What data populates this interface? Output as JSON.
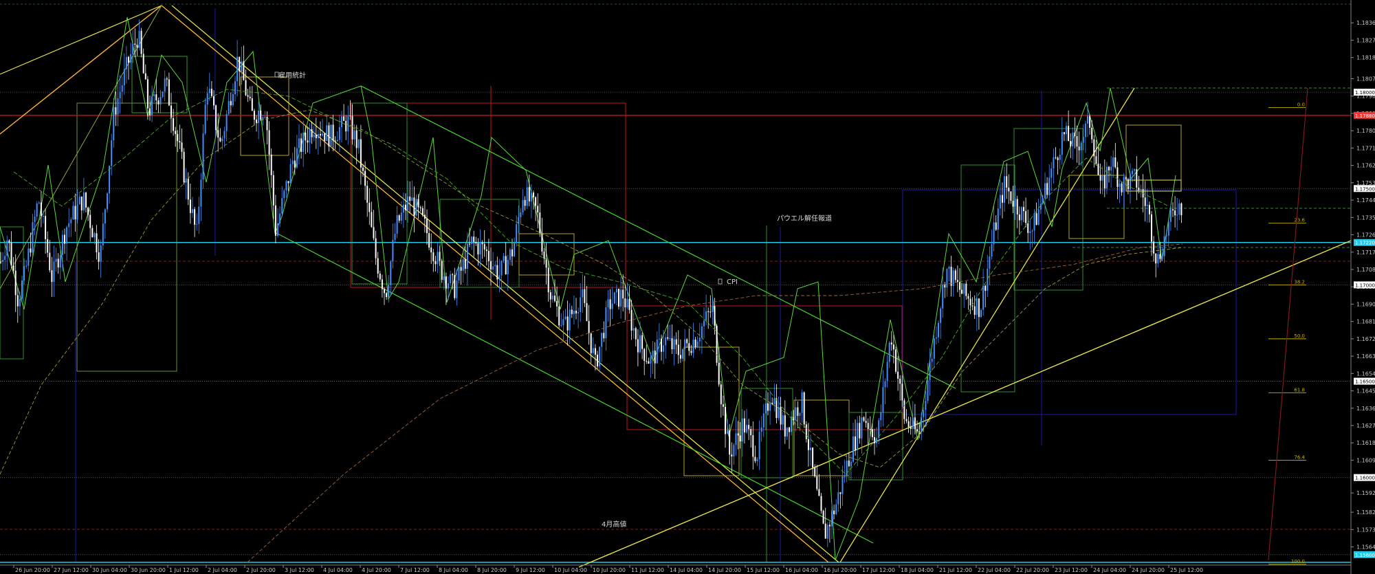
{
  "colors": {
    "background": "#000000",
    "candle_up": "#3f8fff",
    "candle_down": "#ffffff",
    "grid": "#6a6a6a",
    "red_level": "#e00000",
    "cyan_level": "#27c8e6",
    "green_line": "#44d62c",
    "yellow_line": "#e6e24a",
    "orange_line": "#ffb43a",
    "blue_box": "#1a1aa8",
    "red_box": "#c01818",
    "fib": "#c8b400"
  },
  "chart_data": {
    "type": "line",
    "ylim": [
      1.1556,
      1.1845
    ],
    "price_ticks": [
      "1.18360",
      "1.18270",
      "1.18180",
      "1.18070",
      "1.17980",
      "1.17890",
      "1.17800",
      "1.17710",
      "1.17620",
      "1.17530",
      "1.17440",
      "1.17350",
      "1.17260",
      "1.17170",
      "1.17080",
      "1.16990",
      "1.16900",
      "1.16810",
      "1.16720",
      "1.16630",
      "1.16540",
      "1.16450",
      "1.16360",
      "1.16270",
      "1.16180",
      "1.16090",
      "1.15920",
      "1.15820",
      "1.15730",
      "1.15640"
    ],
    "highlight_prices": [
      {
        "label": "1.18000",
        "value": 1.18,
        "color": "#ffffff"
      },
      {
        "label": "1.17880",
        "value": 1.1788,
        "color": "#ff3030"
      },
      {
        "label": "1.17500",
        "value": 1.175,
        "color": "#ffffff"
      },
      {
        "label": "1.17220",
        "value": 1.1722,
        "color": "#27c8e6"
      },
      {
        "label": "1.17000",
        "value": 1.17,
        "color": "#ffffff"
      },
      {
        "label": "1.16500",
        "value": 1.165,
        "color": "#ffffff"
      },
      {
        "label": "1.16000",
        "value": 1.16,
        "color": "#ffffff"
      },
      {
        "label": "1.15600",
        "value": 1.156,
        "color": "#27c8e6"
      }
    ],
    "time_labels": [
      "26 Jun 20:00",
      "27 Jun 12:00",
      "30 Jun 04:00",
      "30 Jun 20:00",
      "1 Jul 12:00",
      "2 Jul 04:00",
      "2 Jul 20:00",
      "3 Jul 12:00",
      "4 Jul 04:00",
      "4 Jul 20:00",
      "7 Jul 12:00",
      "8 Jul 04:00",
      "8 Jul 20:00",
      "9 Jul 12:00",
      "10 Jul 04:00",
      "10 Jul 20:00",
      "11 Jul 12:00",
      "14 Jul 04:00",
      "14 Jul 20:00",
      "15 Jul 12:00",
      "16 Jul 04:00",
      "16 Jul 20:00",
      "17 Jul 12:00",
      "18 Jul 04:00",
      "21 Jul 12:00",
      "22 Jul 04:00",
      "22 Jul 20:00",
      "23 Jul 12:00",
      "24 Jul 04:00",
      "24 Jul 20:00",
      "25 Jul 12:00"
    ],
    "price_path": [
      {
        "x": 0,
        "y": 1.1712
      },
      {
        "x": 10,
        "y": 1.1725
      },
      {
        "x": 25,
        "y": 1.1693
      },
      {
        "x": 35,
        "y": 1.1705
      },
      {
        "x": 55,
        "y": 1.1745
      },
      {
        "x": 75,
        "y": 1.1703
      },
      {
        "x": 95,
        "y": 1.173
      },
      {
        "x": 120,
        "y": 1.1745
      },
      {
        "x": 145,
        "y": 1.1715
      },
      {
        "x": 165,
        "y": 1.179
      },
      {
        "x": 185,
        "y": 1.1815
      },
      {
        "x": 200,
        "y": 1.183
      },
      {
        "x": 215,
        "y": 1.179
      },
      {
        "x": 240,
        "y": 1.1805
      },
      {
        "x": 260,
        "y": 1.177
      },
      {
        "x": 285,
        "y": 1.1725
      },
      {
        "x": 300,
        "y": 1.1805
      },
      {
        "x": 320,
        "y": 1.1772
      },
      {
        "x": 345,
        "y": 1.1818
      },
      {
        "x": 365,
        "y": 1.1788
      },
      {
        "x": 385,
        "y": 1.1792
      },
      {
        "x": 400,
        "y": 1.1728
      },
      {
        "x": 425,
        "y": 1.1765
      },
      {
        "x": 455,
        "y": 1.1783
      },
      {
        "x": 480,
        "y": 1.1777
      },
      {
        "x": 505,
        "y": 1.1785
      },
      {
        "x": 520,
        "y": 1.1772
      },
      {
        "x": 545,
        "y": 1.1715
      },
      {
        "x": 560,
        "y": 1.1695
      },
      {
        "x": 575,
        "y": 1.173
      },
      {
        "x": 595,
        "y": 1.1745
      },
      {
        "x": 615,
        "y": 1.1732
      },
      {
        "x": 640,
        "y": 1.1708
      },
      {
        "x": 660,
        "y": 1.1698
      },
      {
        "x": 685,
        "y": 1.1722
      },
      {
        "x": 705,
        "y": 1.1718
      },
      {
        "x": 725,
        "y": 1.1705
      },
      {
        "x": 745,
        "y": 1.1718
      },
      {
        "x": 760,
        "y": 1.1748
      },
      {
        "x": 780,
        "y": 1.1738
      },
      {
        "x": 800,
        "y": 1.1695
      },
      {
        "x": 820,
        "y": 1.1678
      },
      {
        "x": 845,
        "y": 1.1695
      },
      {
        "x": 865,
        "y": 1.1658
      },
      {
        "x": 885,
        "y": 1.169
      },
      {
        "x": 905,
        "y": 1.1695
      },
      {
        "x": 925,
        "y": 1.1672
      },
      {
        "x": 945,
        "y": 1.166
      },
      {
        "x": 965,
        "y": 1.1672
      },
      {
        "x": 985,
        "y": 1.1665
      },
      {
        "x": 1010,
        "y": 1.1672
      },
      {
        "x": 1035,
        "y": 1.1688
      },
      {
        "x": 1048,
        "y": 1.1642
      },
      {
        "x": 1060,
        "y": 1.1612
      },
      {
        "x": 1080,
        "y": 1.1628
      },
      {
        "x": 1100,
        "y": 1.1612
      },
      {
        "x": 1120,
        "y": 1.1645
      },
      {
        "x": 1140,
        "y": 1.1625
      },
      {
        "x": 1165,
        "y": 1.164
      },
      {
        "x": 1180,
        "y": 1.1605
      },
      {
        "x": 1198,
        "y": 1.157
      },
      {
        "x": 1215,
        "y": 1.1586
      },
      {
        "x": 1235,
        "y": 1.1612
      },
      {
        "x": 1255,
        "y": 1.1632
      },
      {
        "x": 1275,
        "y": 1.162
      },
      {
        "x": 1295,
        "y": 1.1675
      },
      {
        "x": 1315,
        "y": 1.163
      },
      {
        "x": 1335,
        "y": 1.1622
      },
      {
        "x": 1355,
        "y": 1.1665
      },
      {
        "x": 1375,
        "y": 1.1708
      },
      {
        "x": 1400,
        "y": 1.1695
      },
      {
        "x": 1425,
        "y": 1.1688
      },
      {
        "x": 1445,
        "y": 1.1728
      },
      {
        "x": 1460,
        "y": 1.1752
      },
      {
        "x": 1480,
        "y": 1.174
      },
      {
        "x": 1500,
        "y": 1.1728
      },
      {
        "x": 1520,
        "y": 1.175
      },
      {
        "x": 1545,
        "y": 1.1778
      },
      {
        "x": 1565,
        "y": 1.1772
      },
      {
        "x": 1585,
        "y": 1.1785
      },
      {
        "x": 1600,
        "y": 1.1748
      },
      {
        "x": 1615,
        "y": 1.1765
      },
      {
        "x": 1630,
        "y": 1.1752
      },
      {
        "x": 1650,
        "y": 1.1755
      },
      {
        "x": 1668,
        "y": 1.174
      },
      {
        "x": 1682,
        "y": 1.1712
      },
      {
        "x": 1698,
        "y": 1.173
      },
      {
        "x": 1712,
        "y": 1.1742
      },
      {
        "x": 1720,
        "y": 1.174
      }
    ],
    "fib_levels": [
      {
        "label": "0.0",
        "value": 1.1792
      },
      {
        "label": "23.6",
        "value": 1.1732
      },
      {
        "label": "38.2",
        "value": 1.17
      },
      {
        "label": "50.0",
        "value": 1.1672
      },
      {
        "label": "61.8",
        "value": 1.1644
      },
      {
        "label": "76.4",
        "value": 1.1609
      },
      {
        "label": "100.0",
        "value": 1.1555
      }
    ]
  },
  "annotations": [
    {
      "text": "雇用統計",
      "x": 405,
      "y": 113
    },
    {
      "text": "CPI",
      "x": 1057,
      "y": 413
    },
    {
      "text": "パウエル解任報道",
      "x": 1130,
      "y": 321
    },
    {
      "text": "4月高値",
      "x": 875,
      "y": 766
    }
  ]
}
